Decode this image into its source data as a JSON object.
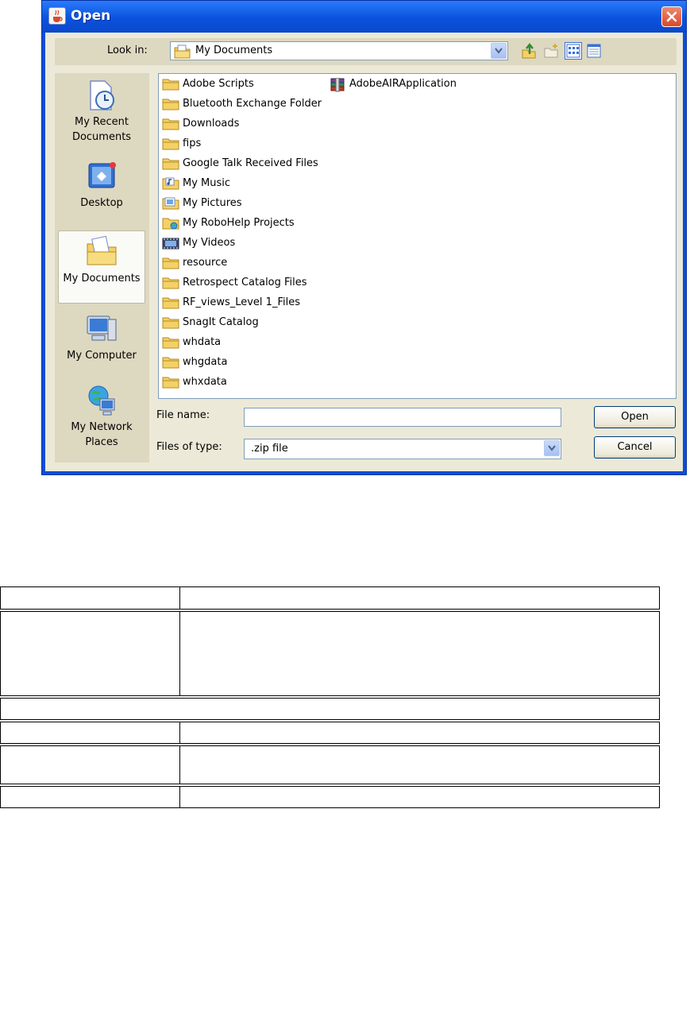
{
  "window": {
    "title": "Open",
    "close_symbol": "×"
  },
  "lookin": {
    "label": "Look in:",
    "value": "My Documents",
    "toolbar": [
      "up-one-level-icon",
      "create-new-folder-icon",
      "list-view-icon",
      "details-view-icon"
    ]
  },
  "places": [
    {
      "label": "My Recent Documents",
      "icon": "recent-documents-icon"
    },
    {
      "label": "Desktop",
      "icon": "desktop-icon"
    },
    {
      "label": "My Documents",
      "icon": "my-documents-icon"
    },
    {
      "label": "My Computer",
      "icon": "my-computer-icon"
    },
    {
      "label": "My Network Places",
      "icon": "network-places-icon"
    }
  ],
  "files": [
    {
      "name": "Adobe Scripts",
      "icon": "folder-icon"
    },
    {
      "name": "Bluetooth Exchange Folder",
      "icon": "folder-icon"
    },
    {
      "name": "Downloads",
      "icon": "folder-icon"
    },
    {
      "name": "fips",
      "icon": "folder-icon"
    },
    {
      "name": "Google Talk Received Files",
      "icon": "folder-icon"
    },
    {
      "name": "My Music",
      "icon": "music-folder-icon"
    },
    {
      "name": "My Pictures",
      "icon": "pictures-folder-icon"
    },
    {
      "name": "My RoboHelp Projects",
      "icon": "network-folder-icon"
    },
    {
      "name": "My Videos",
      "icon": "videos-folder-icon"
    },
    {
      "name": "resource",
      "icon": "folder-icon"
    },
    {
      "name": "Retrospect Catalog Files",
      "icon": "folder-icon"
    },
    {
      "name": "RF_views_Level 1_Files",
      "icon": "folder-icon"
    },
    {
      "name": "SnagIt Catalog",
      "icon": "folder-icon"
    },
    {
      "name": "whdata",
      "icon": "folder-icon"
    },
    {
      "name": "whgdata",
      "icon": "folder-icon"
    },
    {
      "name": "whxdata",
      "icon": "folder-icon"
    },
    {
      "name": "AdobeAIRApplication",
      "icon": "archive-icon"
    }
  ],
  "file_name": {
    "label": "File name:",
    "value": ""
  },
  "files_of_type": {
    "label": "Files of type:",
    "value": ".zip file"
  },
  "buttons": {
    "open": "Open",
    "cancel": "Cancel"
  },
  "colors": {
    "title_bar": "#0a52dd",
    "dialog_bg": "#ece9d8",
    "folder": "#f4d166"
  }
}
